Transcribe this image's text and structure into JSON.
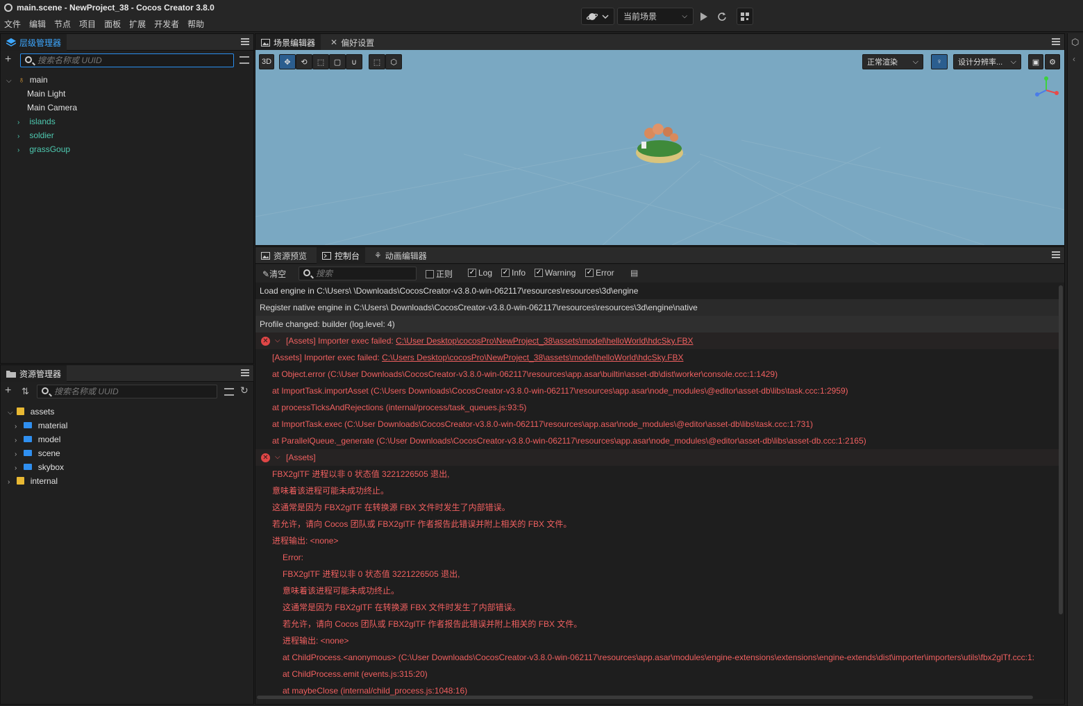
{
  "window": {
    "title": "main.scene - NewProject_38 - Cocos Creator 3.8.0"
  },
  "menu": [
    "文件",
    "编辑",
    "节点",
    "项目",
    "面板",
    "扩展",
    "开发者",
    "帮助"
  ],
  "toolbar": {
    "scene_select": "当前场景"
  },
  "hierarchy": {
    "tab": "层级管理器",
    "search_placeholder": "搜索名称或 UUID",
    "root": "main",
    "items": [
      {
        "label": "Main Light"
      },
      {
        "label": "Main Camera"
      },
      {
        "label": "islands"
      },
      {
        "label": "soldier"
      },
      {
        "label": "grassGoup"
      }
    ]
  },
  "assets_panel": {
    "tab": "资源管理器",
    "search_placeholder": "搜索名称或 UUID",
    "root": "assets",
    "items": [
      {
        "label": "material"
      },
      {
        "label": "model"
      },
      {
        "label": "scene"
      },
      {
        "label": "skybox"
      }
    ],
    "internal": "internal"
  },
  "scene_tabs": {
    "editor": "场景编辑器",
    "prefs": "偏好设置"
  },
  "scene_toolbar": {
    "mode3d": "3D",
    "render": "正常渲染",
    "resolution": "设计分辨率..."
  },
  "console_tabs": {
    "preview": "资源预览",
    "console": "控制台",
    "anim": "动画编辑器"
  },
  "console_toolbar": {
    "clear": "清空",
    "search_placeholder": "搜索",
    "regex": "正则",
    "log": "Log",
    "info": "Info",
    "warning": "Warning",
    "error": "Error"
  },
  "logs": [
    {
      "text": "Load engine in C:\\Users\\      \\Downloads\\CocosCreator-v3.8.0-win-062117\\resources\\resources\\3d\\engine"
    },
    {
      "text": "Register native engine in C:\\Users\\      Downloads\\CocosCreator-v3.8.0-win-062117\\resources\\resources\\3d\\engine\\native"
    },
    {
      "text": "Profile changed: builder (log.level: 4)"
    },
    {
      "prefix": "[Assets] Importer exec failed: ",
      "link": "C:\\User        Desktop\\cocosPro\\NewProject_38\\assets\\model\\helloWorld\\hdcSky.FBX"
    },
    {
      "prefix": "[Assets] Importer exec failed: ",
      "link": "C:\\Users         Desktop\\cocosPro\\NewProject_38\\assets\\model\\helloWorld\\hdcSky.FBX"
    },
    {
      "text": "at Object.error (C:\\User         Downloads\\CocosCreator-v3.8.0-win-062117\\resources\\app.asar\\builtin\\asset-db\\dist\\worker\\console.ccc:1:1429)"
    },
    {
      "text": "at ImportTask.importAsset (C:\\Users          Downloads\\CocosCreator-v3.8.0-win-062117\\resources\\app.asar\\node_modules\\@editor\\asset-db\\libs\\task.ccc:1:2959)"
    },
    {
      "text": "at processTicksAndRejections (internal/process/task_queues.js:93:5)"
    },
    {
      "text": "at ImportTask.exec (C:\\User         Downloads\\CocosCreator-v3.8.0-win-062117\\resources\\app.asar\\node_modules\\@editor\\asset-db\\libs\\task.ccc:1:731)"
    },
    {
      "text": "at ParallelQueue._generate (C:\\User          Downloads\\CocosCreator-v3.8.0-win-062117\\resources\\app.asar\\node_modules\\@editor\\asset-db\\libs\\asset-db.ccc:1:2165)"
    },
    {
      "text": "[Assets]"
    },
    {
      "text": "FBX2glTF 进程以非 0 状态值 3221226505 退出,"
    },
    {
      "text": "意味着该进程可能未成功终止。"
    },
    {
      "text": "这通常是因为 FBX2glTF 在转换源 FBX 文件时发生了内部错误。"
    },
    {
      "text": "若允许，请向 Cocos 团队或 FBX2glTF 作者报告此错误并附上相关的 FBX 文件。"
    },
    {
      "text": "进程输出: <none>"
    },
    {
      "text": "Error:"
    },
    {
      "text": "FBX2glTF 进程以非 0 状态值 3221226505 退出,"
    },
    {
      "text": "意味着该进程可能未成功终止。"
    },
    {
      "text": "这通常是因为 FBX2glTF 在转换源 FBX 文件时发生了内部错误。"
    },
    {
      "text": "若允许，请向 Cocos 团队或 FBX2glTF 作者报告此错误并附上相关的 FBX 文件。"
    },
    {
      "text": "进程输出: <none>"
    },
    {
      "text": "at ChildProcess.<anonymous> (C:\\User          Downloads\\CocosCreator-v3.8.0-win-062117\\resources\\app.asar\\modules\\engine-extensions\\extensions\\engine-extends\\dist\\importer\\importers\\utils\\fbx2glTf.ccc:1:"
    },
    {
      "text": "at ChildProcess.emit (events.js:315:20)"
    },
    {
      "text": "at maybeClose (internal/child_process.js:1048:16)"
    }
  ]
}
